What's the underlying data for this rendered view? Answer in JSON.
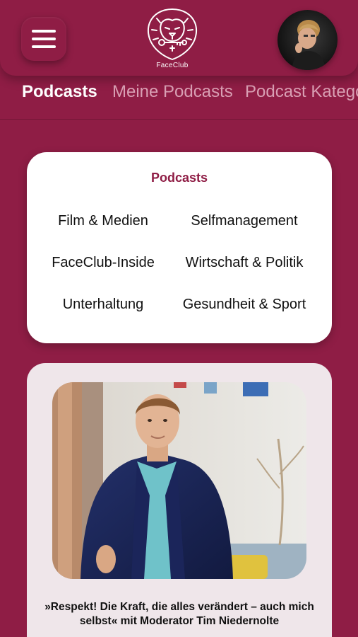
{
  "header": {
    "logo_text": "FaceClub",
    "icons": {
      "menu": "hamburger-menu-icon",
      "logo": "lion-logo-icon"
    }
  },
  "tabs": [
    {
      "label": "Podcasts",
      "active": true
    },
    {
      "label": "Meine Podcasts",
      "active": false
    },
    {
      "label": "Podcast Katego",
      "active": false
    }
  ],
  "categories": {
    "title": "Podcasts",
    "items": [
      "Film & Medien",
      "Selfmanagement",
      "FaceClub-Inside",
      "Wirtschaft & Politik",
      "Unterhaltung",
      "Gesundheit & Sport"
    ]
  },
  "podcast": {
    "title": "»Respekt! Die Kraft, die alles verändert – auch mich selbst« mit Moderator Tim Niedernolte"
  },
  "colors": {
    "brand": "#8f1d45",
    "card": "#ffffff",
    "podcast_card": "#efe6ea",
    "tab_inactive": "#d9a0b4"
  }
}
